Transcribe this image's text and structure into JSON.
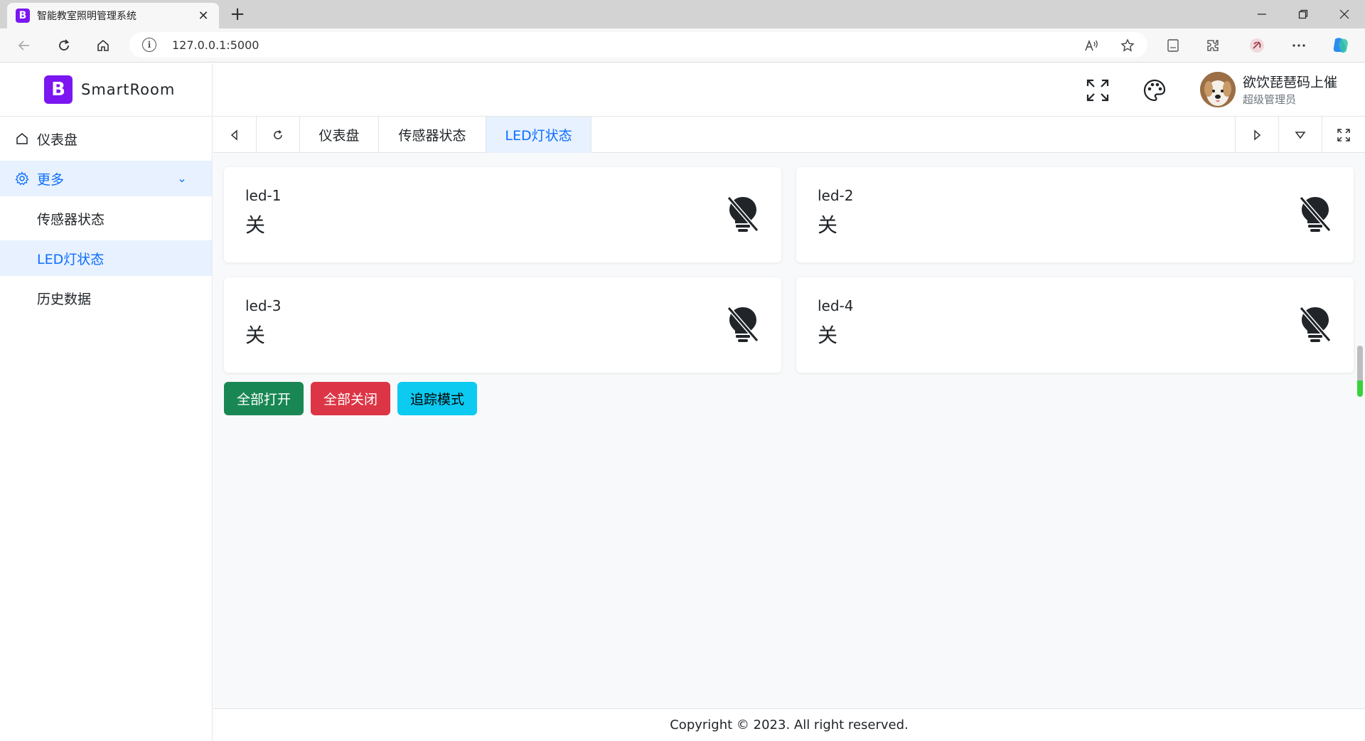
{
  "browser": {
    "tab_title": "智能教室照明管理系统",
    "favicon_letter": "B",
    "url": "127.0.0.1:5000"
  },
  "app": {
    "brand_letter": "B",
    "brand_name": "SmartRoom",
    "accent": "#0d6efd",
    "brand_color": "#7b16f1"
  },
  "sidebar": {
    "items": [
      {
        "label": "仪表盘",
        "icon": "home-icon"
      },
      {
        "label": "更多",
        "icon": "gear-icon",
        "expanded": true
      }
    ],
    "subitems": [
      {
        "label": "传感器状态"
      },
      {
        "label": "LED灯状态",
        "active": true
      },
      {
        "label": "历史数据"
      }
    ]
  },
  "header": {
    "user_name": "欲饮琵琶码上催",
    "user_role": "超级管理员"
  },
  "tabs": [
    {
      "label": "仪表盘"
    },
    {
      "label": "传感器状态"
    },
    {
      "label": "LED灯状态",
      "active": true
    }
  ],
  "leds": [
    {
      "name": "led-1",
      "state": "关"
    },
    {
      "name": "led-2",
      "state": "关"
    },
    {
      "name": "led-3",
      "state": "关"
    },
    {
      "name": "led-4",
      "state": "关"
    }
  ],
  "actions": {
    "all_on": "全部打开",
    "all_off": "全部关闭",
    "tracking": "追踪模式"
  },
  "footer": {
    "copyright": "Copyright © 2023. All right reserved."
  }
}
